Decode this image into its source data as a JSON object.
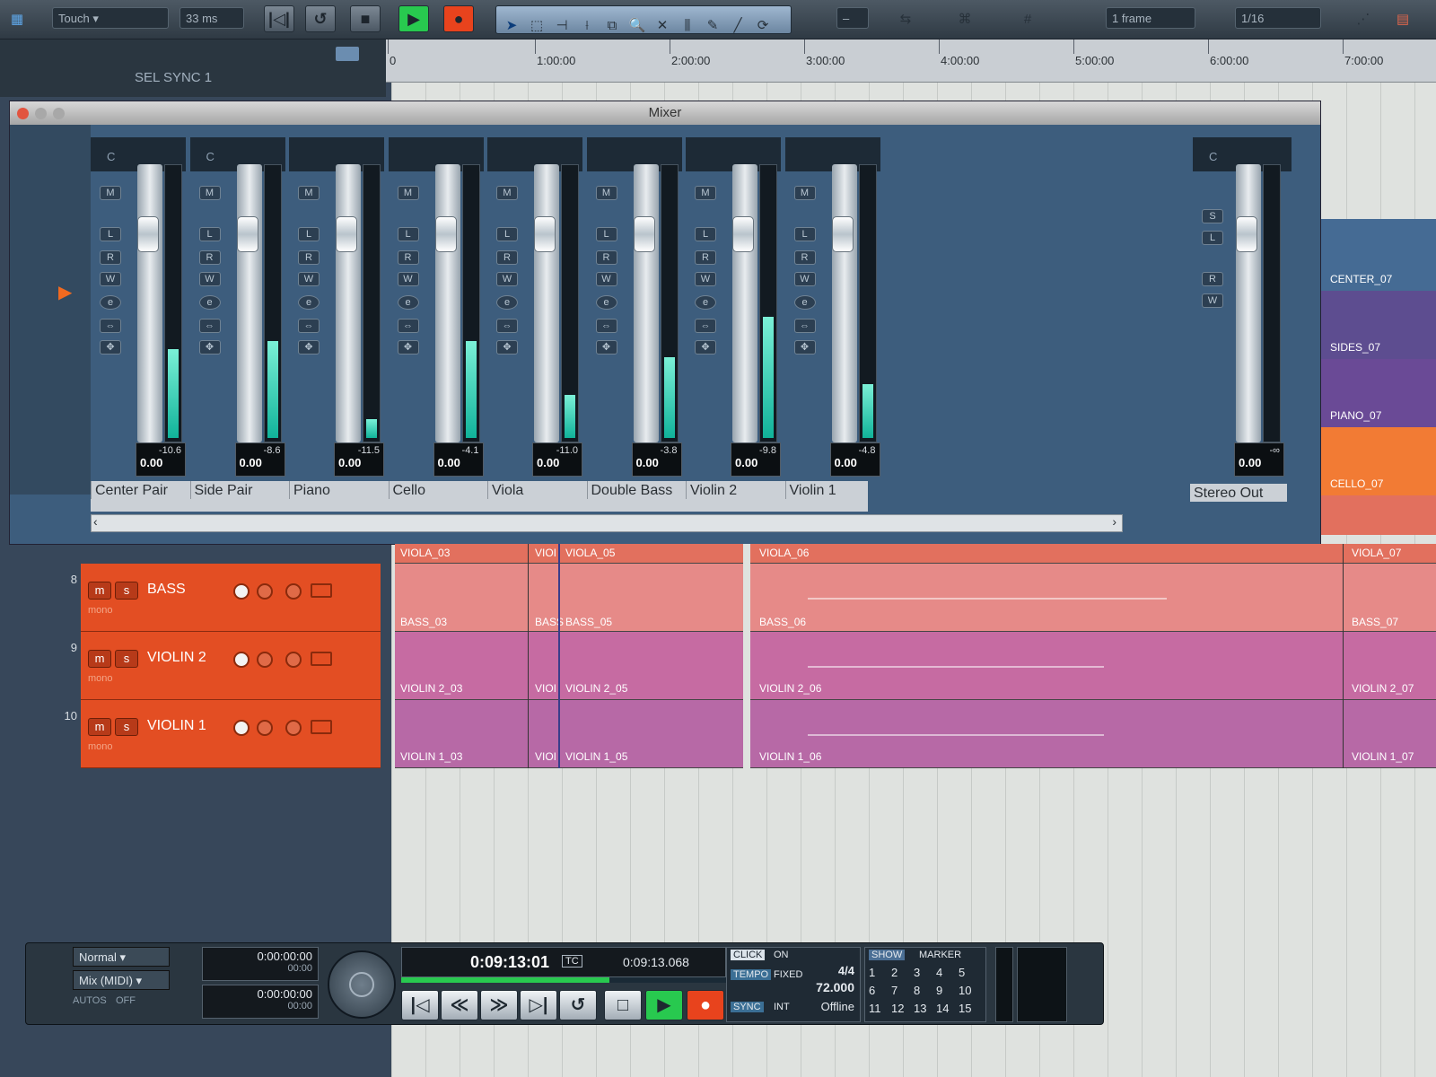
{
  "toolbar": {
    "automation_mode": "Touch",
    "latency": "33 ms",
    "nudge_value": "1 frame",
    "snap_value": "1/16",
    "colors": {
      "play": "#28c94f",
      "record": "#e8431d"
    }
  },
  "ruler": {
    "ticks": [
      "0",
      "1:00:00",
      "2:00:00",
      "3:00:00",
      "4:00:00",
      "5:00:00",
      "6:00:00",
      "7:00:00"
    ]
  },
  "sel_sync": "SEL SYNC 1",
  "mixer": {
    "title": "Mixer",
    "strips": [
      {
        "name": "Center Pair",
        "pan": "C",
        "gain": "0.00",
        "peak": "-10.6",
        "level": 0.33
      },
      {
        "name": "Side Pair",
        "pan": "C",
        "gain": "0.00",
        "peak": "-8.6",
        "level": 0.36
      },
      {
        "name": "Piano",
        "pan": "",
        "gain": "0.00",
        "peak": "-11.5",
        "level": 0.07
      },
      {
        "name": "Cello",
        "pan": "",
        "gain": "0.00",
        "peak": "-4.1",
        "level": 0.36
      },
      {
        "name": "Viola",
        "pan": "",
        "gain": "0.00",
        "peak": "-11.0",
        "level": 0.16
      },
      {
        "name": "Double Bass",
        "pan": "",
        "gain": "0.00",
        "peak": "-3.8",
        "level": 0.3
      },
      {
        "name": "Violin 2",
        "pan": "",
        "gain": "0.00",
        "peak": "-9.8",
        "level": 0.45
      },
      {
        "name": "Violin 1",
        "pan": "",
        "gain": "0.00",
        "peak": "-4.8",
        "level": 0.2
      }
    ],
    "stereo_out": {
      "name": "Stereo Out",
      "pan": "C",
      "gain": "0.00",
      "peak": "-∞"
    }
  },
  "tracks": [
    {
      "number": "8",
      "name": "BASS",
      "type": "mono"
    },
    {
      "number": "9",
      "name": "VIOLIN 2",
      "type": "mono"
    },
    {
      "number": "10",
      "name": "VIOLIN 1",
      "type": "mono"
    }
  ],
  "clips": {
    "viola": [
      "VIOLA_03",
      "VIOI",
      "VIOLA_05",
      "VIOLA_06",
      "VIOLA_07"
    ],
    "bass": [
      "BASS_03",
      "BASS",
      "BASS_05",
      "BASS_06",
      "BASS_07"
    ],
    "violin2": [
      "VIOLIN 2_03",
      "VIOI",
      "VIOLIN 2_05",
      "VIOLIN 2_06",
      "VIOLIN 2_07"
    ],
    "violin1": [
      "VIOLIN 1_03",
      "VIOI",
      "VIOLIN 1_05",
      "VIOLIN 1_06",
      "VIOLIN 1_07"
    ],
    "right_labels": [
      "CENTER_07",
      "SIDES_07",
      "PIANO_07",
      "CELLO_07"
    ]
  },
  "transport": {
    "mode": "Normal",
    "record_mode": "Mix (MIDI)",
    "auto_label": "AUTOS",
    "auto_value": "OFF",
    "punch_in": "0:00:00:00",
    "punch_in_sub": "00:00",
    "punch_out": "0:00:00:00",
    "punch_out_sub": "00:00",
    "main_time": "0:09:13:01",
    "main_format": "TC",
    "secondary_time": "0:09:13.068",
    "click_label": "CLICK",
    "click_value": "ON",
    "tempo_label": "TEMPO",
    "tempo_mode": "FIXED",
    "meter": "4/4",
    "tempo": "72.000",
    "sync_label": "SYNC",
    "sync_mode": "INT",
    "sync_status": "Offline",
    "show_label": "SHOW",
    "marker_label": "MARKER",
    "markers": [
      "1",
      "2",
      "3",
      "4",
      "5",
      "6",
      "7",
      "8",
      "9",
      "10",
      "11",
      "12",
      "13",
      "14",
      "15"
    ]
  }
}
